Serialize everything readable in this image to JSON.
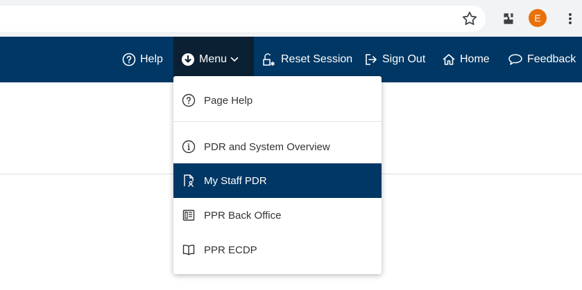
{
  "colors": {
    "header_bg": "#003764",
    "menu_active_bg": "#0b2033",
    "dropdown_selected_bg": "#003764",
    "avatar_bg": "#e8710a"
  },
  "browser": {
    "profile_initial": "E",
    "icons": [
      "star-icon",
      "extensions-puzzle-icon",
      "kebab-menu-icon"
    ]
  },
  "header": {
    "help_label": "Help",
    "menu_label": "Menu",
    "reset_label": "Reset Session",
    "signout_label": "Sign Out",
    "home_label": "Home",
    "feedback_label": "Feedback"
  },
  "dropdown": {
    "items": [
      {
        "label": "Page Help",
        "icon": "question-circle-icon"
      },
      {
        "label": "PDR and System Overview",
        "icon": "info-circle-icon"
      },
      {
        "label": "My Staff PDR",
        "icon": "staff-document-icon",
        "selected": true
      },
      {
        "label": "PPR Back Office",
        "icon": "back-office-icon"
      },
      {
        "label": "PPR ECDP",
        "icon": "open-book-icon"
      }
    ]
  }
}
